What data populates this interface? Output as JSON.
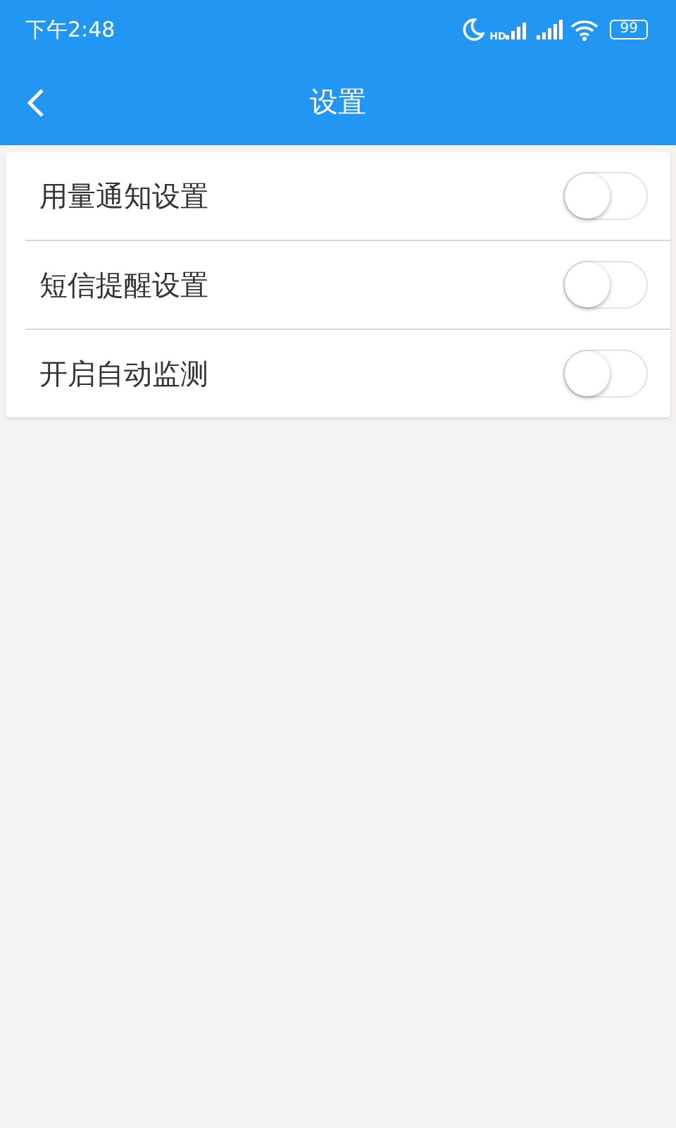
{
  "status_bar": {
    "time": "下午2:48",
    "network_label": "HD",
    "battery": "99"
  },
  "header": {
    "title": "设置"
  },
  "settings": [
    {
      "label": "用量通知设置",
      "on": false
    },
    {
      "label": "短信提醒设置",
      "on": false
    },
    {
      "label": "开启自动监测",
      "on": false
    }
  ]
}
